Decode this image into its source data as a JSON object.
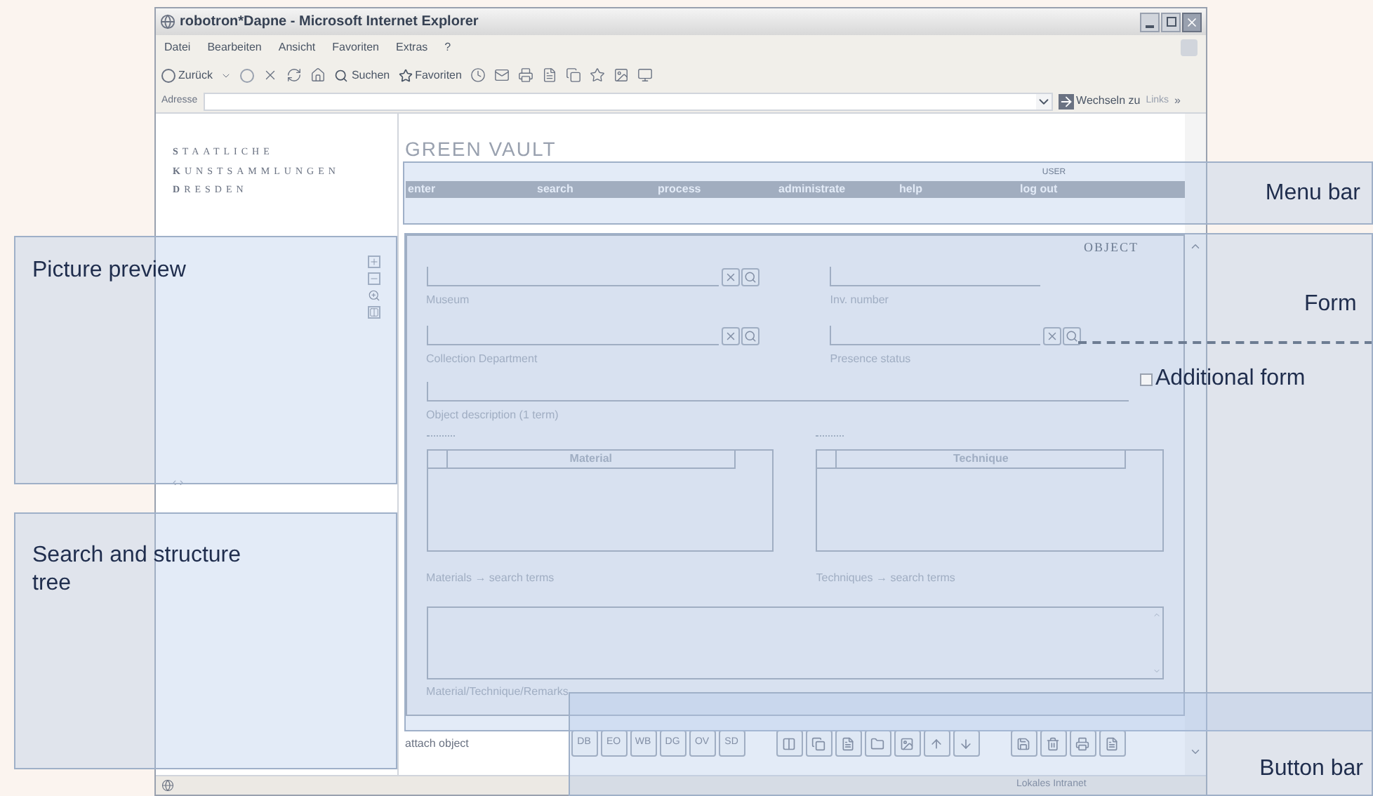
{
  "window": {
    "title": "robotron*Dapne - Microsoft Internet Explorer"
  },
  "menu_bar": [
    "Datei",
    "Bearbeiten",
    "Ansicht",
    "Favoriten",
    "Extras",
    "?"
  ],
  "toolbar": {
    "back": "Zurück",
    "search": "Suchen",
    "favorites": "Favoriten"
  },
  "address_bar": {
    "label": "Adresse",
    "go": "Wechseln zu",
    "links": "Links",
    "more": "»"
  },
  "logo": [
    "**S**TAATLICHE",
    "**K**UNSTSAMMLUNGEN",
    "**D**RESDEN"
  ],
  "page_title": "GREEN VAULT",
  "user_label": "USER",
  "nav": [
    "enter",
    "search",
    "process",
    "administrate",
    "help",
    "log out"
  ],
  "preview": {
    "pager": "‹ ›"
  },
  "form": {
    "title": "OBJECT",
    "fields": [
      {
        "label": "Museum",
        "clearable": true
      },
      {
        "label": "Inv. number",
        "clearable": false
      },
      {
        "label": "Collection Department",
        "clearable": true
      },
      {
        "label": "Presence status",
        "clearable": true
      }
    ],
    "description": {
      "label": "Object description (1 term)"
    },
    "tables": [
      {
        "header": "Material",
        "caption": "Materials → search terms"
      },
      {
        "header": "Technique",
        "caption": "Techniques → search terms"
      }
    ],
    "remarks": {
      "label": "Material/Technique/Remarks"
    }
  },
  "attach": "attach object",
  "code_buttons": [
    "DB",
    "EO",
    "WB",
    "DG",
    "OV",
    "SD"
  ],
  "status_bar": {
    "zone": "Lokales Intranet"
  },
  "annotations": [
    {
      "kind": "menu",
      "label": "Menu bar"
    },
    {
      "kind": "preview",
      "label": "Picture preview"
    },
    {
      "kind": "tree",
      "label": "Search and structure tree"
    },
    {
      "kind": "form",
      "label": "Form"
    },
    {
      "kind": "additional",
      "label": "Additional form"
    },
    {
      "kind": "buttons",
      "label": "Button bar"
    }
  ]
}
